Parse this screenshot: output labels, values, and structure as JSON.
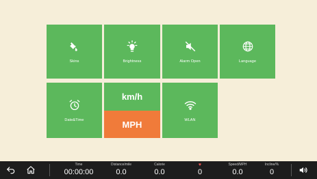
{
  "tiles": {
    "skins": "Skins",
    "brightness": "Brightness",
    "alarm": "Alarm Open",
    "language": "Language",
    "datetime": "Date&Time",
    "wlan": "WLAN"
  },
  "units": {
    "kmh": "km/h",
    "mph": "MPH",
    "selected": "MPH"
  },
  "stats": {
    "time": {
      "label": "Time",
      "value": "00:00:00"
    },
    "distance": {
      "label": "Distance/mile",
      "value": "0.0"
    },
    "calorie": {
      "label": "Calorie",
      "value": "0.0"
    },
    "heart": {
      "value": "0"
    },
    "speed": {
      "label": "Speed/MPH",
      "value": "0.0"
    },
    "incline": {
      "label": "Incline/%",
      "value": "0"
    }
  },
  "colors": {
    "tile": "#5cb85c",
    "selected_unit": "#f07b3a",
    "background": "#f6eed9",
    "bar": "#1d1d1d",
    "heart": "#e8524f"
  },
  "icons": [
    "back-icon",
    "home-icon",
    "paint-bucket-icon",
    "brightness-icon",
    "mute-icon",
    "globe-icon",
    "alarm-clock-icon",
    "wifi-icon",
    "heart-icon",
    "volume-icon"
  ]
}
